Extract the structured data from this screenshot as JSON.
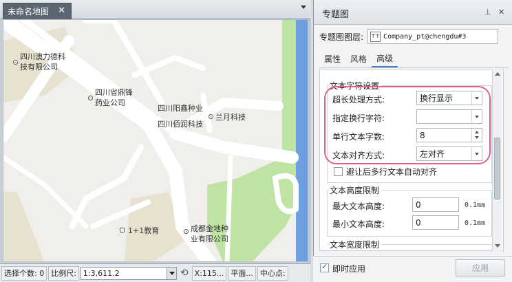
{
  "map_tab": {
    "title": "未命名地图",
    "close": "✕"
  },
  "map": {
    "pois": [
      {
        "name": "四川澳力德科\n技有限公司"
      },
      {
        "name": "四川省鼎锋\n药业公司"
      },
      {
        "name": "四川阳鑫种业"
      },
      {
        "name": "兰月科技"
      },
      {
        "name": "四川佰润科技"
      },
      {
        "name": "1+1教育"
      },
      {
        "name": "成都金地种\n业有限公司"
      }
    ]
  },
  "statusbar": {
    "selected": "选择个数: 0",
    "scale_label": "比例尺:",
    "scale_value": "1:3,611.2",
    "x": "X:115...",
    "projection": "平面...",
    "center": "中心点:"
  },
  "panel": {
    "title": "专题图",
    "pin": "⊥",
    "close": "✕",
    "layer_label": "专题图图层:",
    "layer_value": "Company_pt@chengdu#3",
    "layer_icon": "T T",
    "tabs": [
      "属性",
      "风格",
      "高级"
    ],
    "active_tab": "高级",
    "text_settings": {
      "title": "文本字符设置",
      "overlength_label": "超长处理方式:",
      "overlength_value": "换行显示",
      "wrap_char_label": "指定换行字符:",
      "wrap_char_value": "",
      "chars_per_line_label": "单行文本字数:",
      "chars_per_line_value": "8",
      "align_label": "文本对齐方式:",
      "align_value": "左对齐",
      "avoid_label": "避让后多行文本自动对齐",
      "avoid_checked": false
    },
    "height_limit": {
      "title": "文本高度限制",
      "max_label": "最大文本高度:",
      "max_value": "0",
      "max_unit": "0.1mm",
      "min_label": "最小文本高度:",
      "min_value": "0",
      "min_unit": "0.1mm"
    },
    "width_limit": {
      "title": "文本宽度限制"
    },
    "footer": {
      "instant_apply_label": "即时应用",
      "instant_apply_checked": true,
      "apply_label": "应用"
    }
  },
  "colors": {
    "highlight": "#e0608a",
    "road": "#ffffff",
    "green": "#bfe3a3",
    "river": "#6f9fe0",
    "block": "#e7e2cf"
  }
}
